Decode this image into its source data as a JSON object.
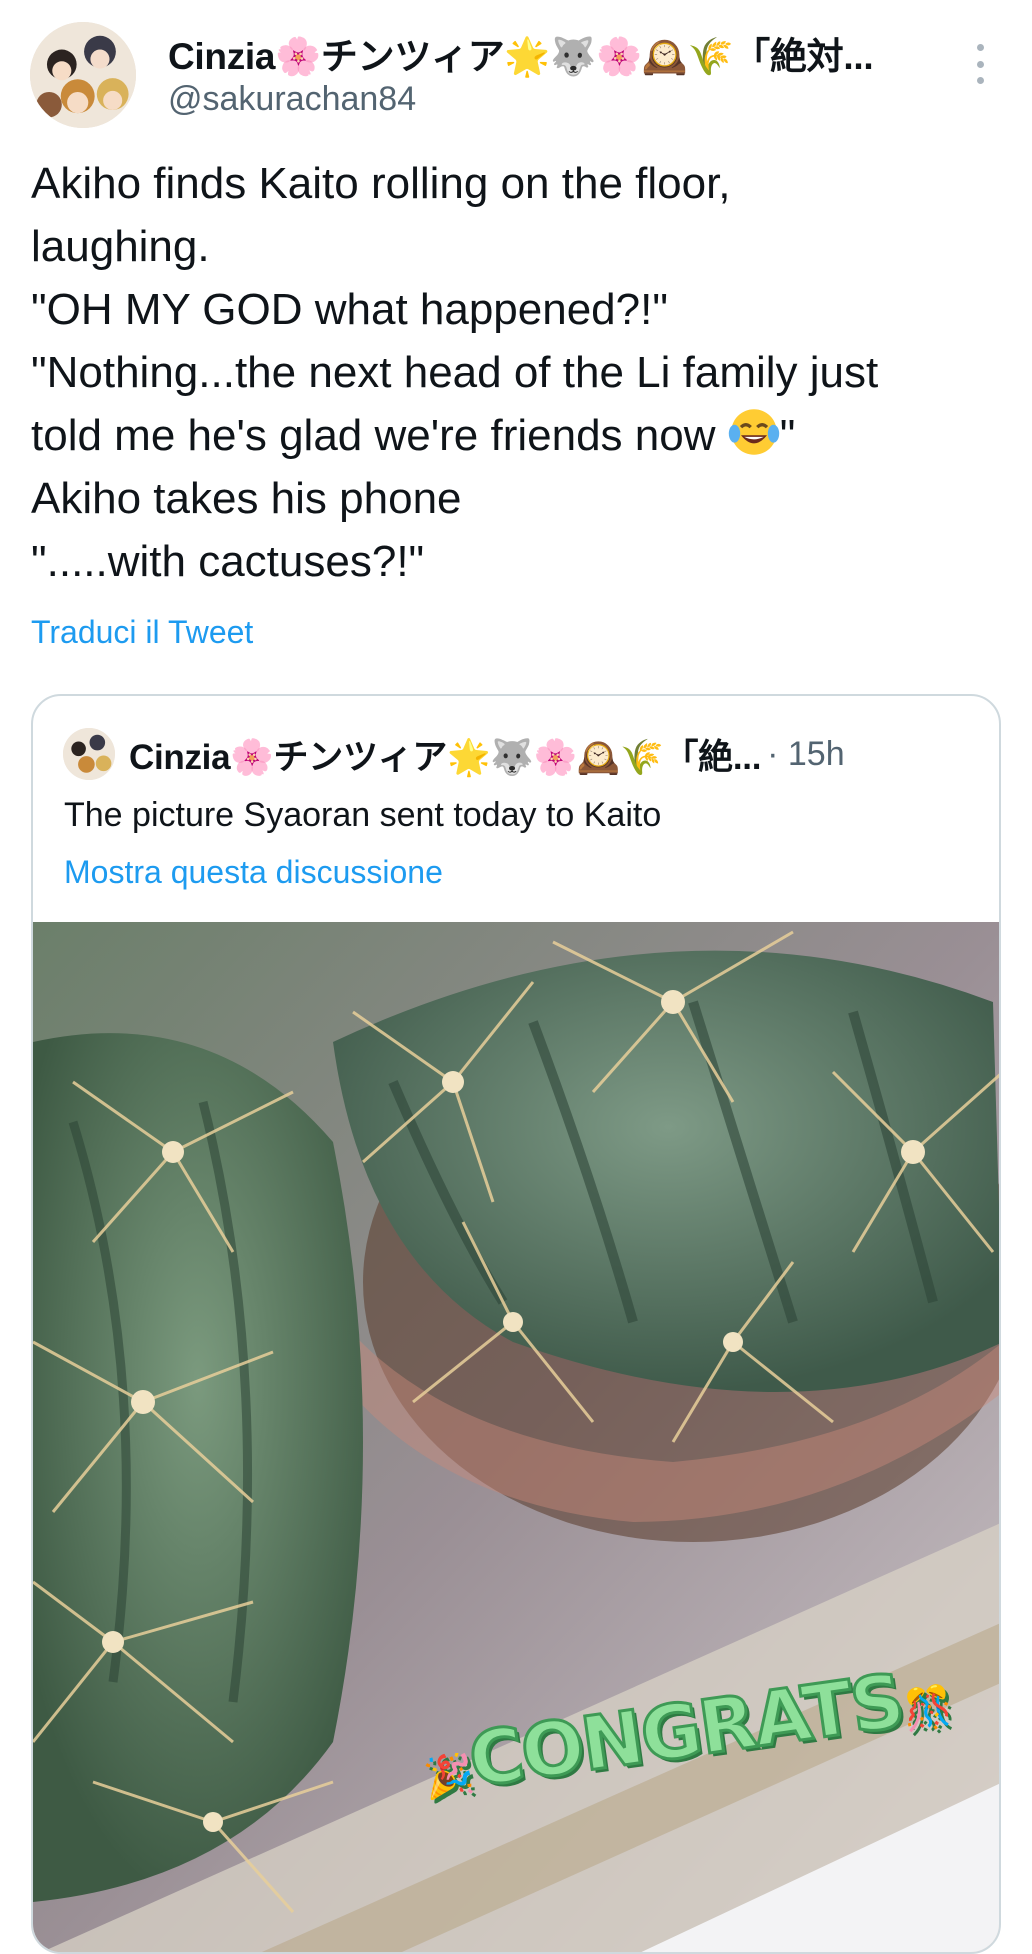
{
  "author": {
    "display_name": "Cinzia🌸チンツィア🌟🐺🌸🕰️🌾「絶対...",
    "handle": "@sakurachan84"
  },
  "tweet": {
    "lines": [
      "Akiho finds Kaito rolling on the floor,",
      "laughing.",
      "\"OH MY GOD what happened?!\"",
      "\"Nothing...the next head of the Li family just",
      "told me he's glad we're friends now",
      "Akiho takes his phone",
      "\".....with cactuses?!\""
    ],
    "line5_suffix": "\"",
    "translate_label": "Traduci il Tweet"
  },
  "quote": {
    "display_name": "Cinzia🌸チンツィア🌟🐺🌸🕰️🌾「絶...",
    "time": "· 15h",
    "text": "The picture Syaoran sent today to Kaito",
    "thread_link": "Mostra questa discussione",
    "sticker_text": "CONGRATS"
  },
  "icons": {
    "more": "more-vertical-icon",
    "laugh": "face-with-tears-of-joy-icon"
  },
  "colors": {
    "link": "#1d9bf0",
    "secondary_text": "#536471",
    "primary_text": "#0f1419",
    "border": "#cfd9de"
  }
}
